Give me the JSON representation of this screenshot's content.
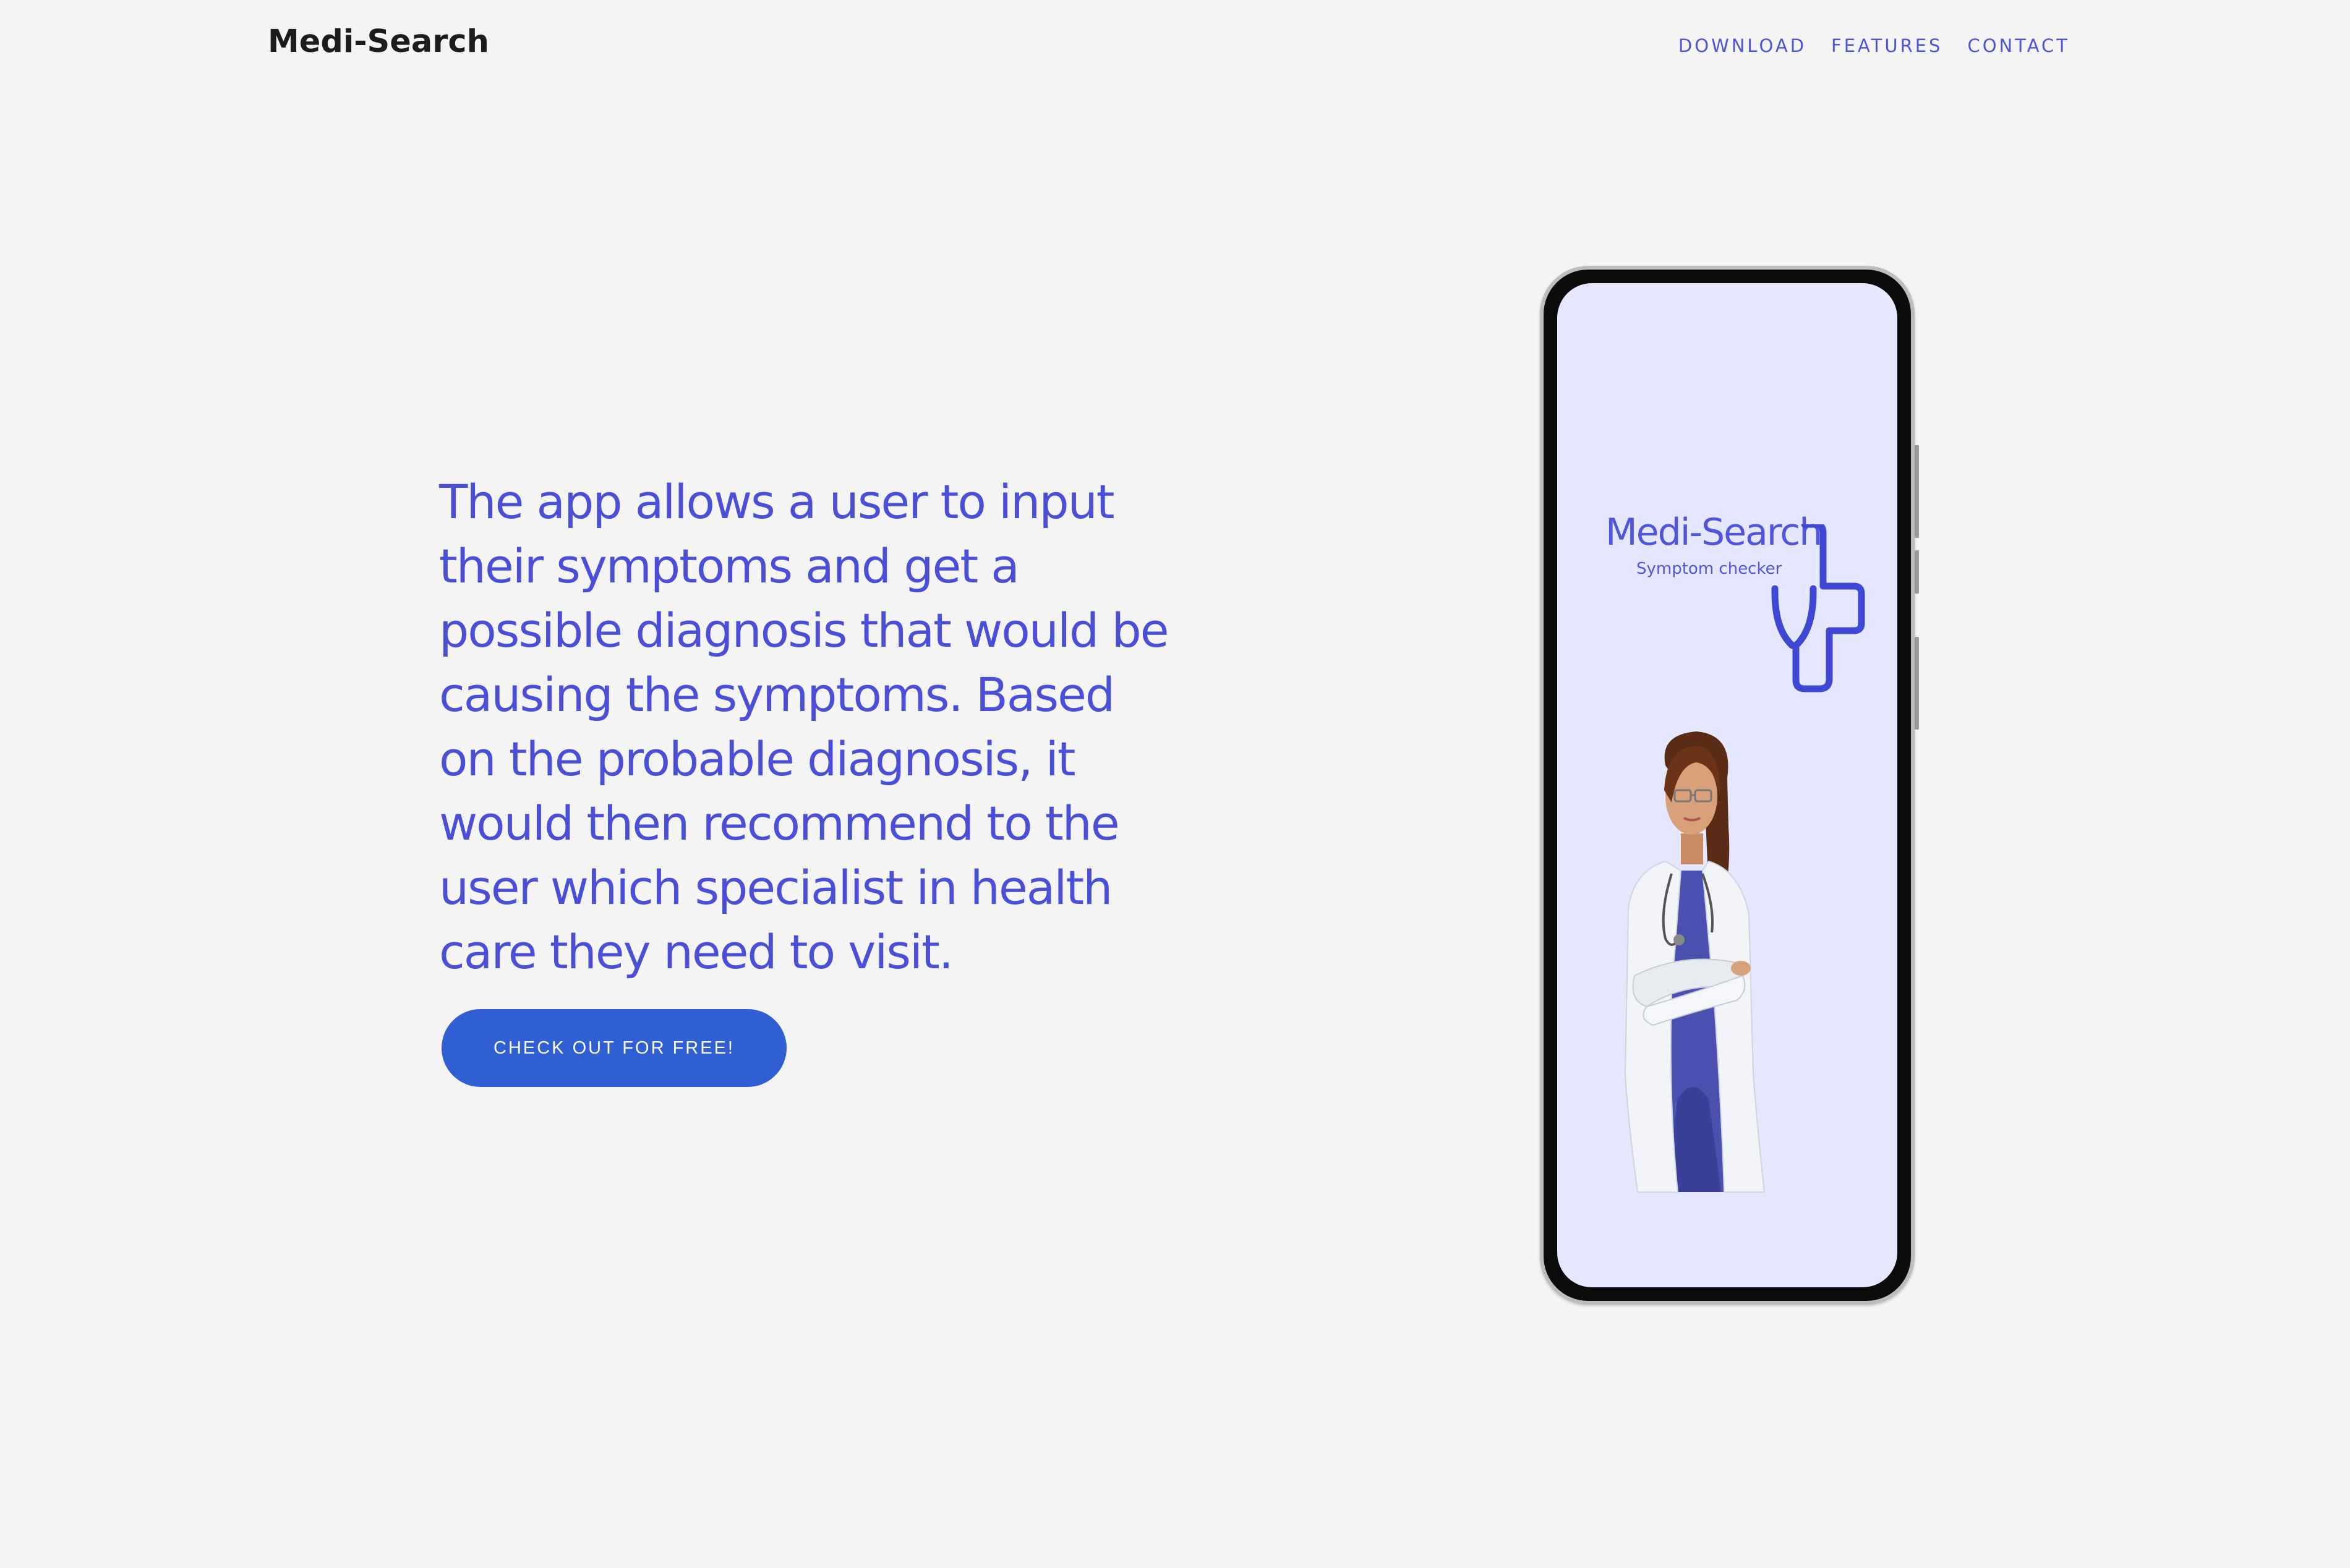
{
  "header": {
    "brand": "Medi-Search",
    "nav": [
      {
        "label": "DOWNLOAD"
      },
      {
        "label": "FEATURES"
      },
      {
        "label": "CONTACT"
      }
    ]
  },
  "hero": {
    "description": "The app allows a user to input their symptoms and get a possible diagnosis that would be causing the symptoms. Based on the probable diagnosis, it would then recommend to the user which specialist in health care they need to visit.",
    "cta_label": "CHECK OUT FOR FREE!"
  },
  "phone_screen": {
    "app_name": "Medi-Search",
    "tagline": "Symptom checker"
  },
  "colors": {
    "accent": "#4a4fd8",
    "button": "#2f5fd3",
    "background": "#f4f4f4",
    "screen": "#e4e7fd"
  },
  "icons": [
    "stethoscope-cross-icon",
    "doctor-illustration"
  ]
}
